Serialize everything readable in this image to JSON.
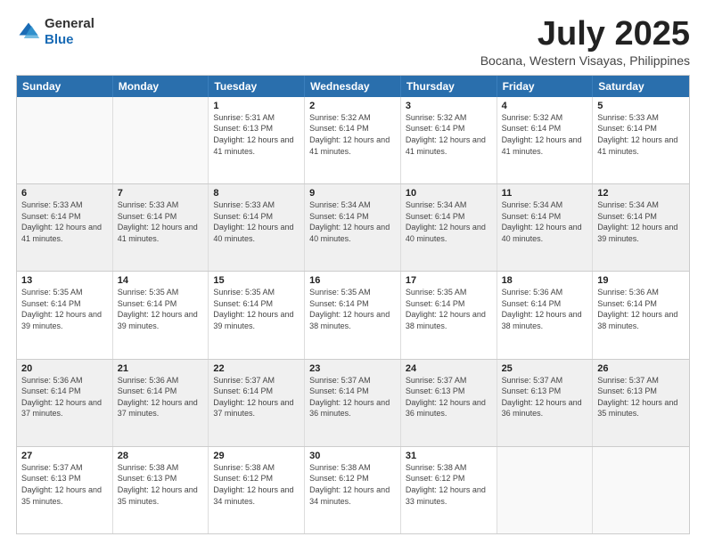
{
  "header": {
    "logo_general": "General",
    "logo_blue": "Blue",
    "month_title": "July 2025",
    "location": "Bocana, Western Visayas, Philippines"
  },
  "weekdays": [
    "Sunday",
    "Monday",
    "Tuesday",
    "Wednesday",
    "Thursday",
    "Friday",
    "Saturday"
  ],
  "rows": [
    [
      {
        "day": "",
        "info": "",
        "empty": true
      },
      {
        "day": "",
        "info": "",
        "empty": true
      },
      {
        "day": "1",
        "info": "Sunrise: 5:31 AM\nSunset: 6:13 PM\nDaylight: 12 hours and 41 minutes."
      },
      {
        "day": "2",
        "info": "Sunrise: 5:32 AM\nSunset: 6:14 PM\nDaylight: 12 hours and 41 minutes."
      },
      {
        "day": "3",
        "info": "Sunrise: 5:32 AM\nSunset: 6:14 PM\nDaylight: 12 hours and 41 minutes."
      },
      {
        "day": "4",
        "info": "Sunrise: 5:32 AM\nSunset: 6:14 PM\nDaylight: 12 hours and 41 minutes."
      },
      {
        "day": "5",
        "info": "Sunrise: 5:33 AM\nSunset: 6:14 PM\nDaylight: 12 hours and 41 minutes."
      }
    ],
    [
      {
        "day": "6",
        "info": "Sunrise: 5:33 AM\nSunset: 6:14 PM\nDaylight: 12 hours and 41 minutes."
      },
      {
        "day": "7",
        "info": "Sunrise: 5:33 AM\nSunset: 6:14 PM\nDaylight: 12 hours and 41 minutes."
      },
      {
        "day": "8",
        "info": "Sunrise: 5:33 AM\nSunset: 6:14 PM\nDaylight: 12 hours and 40 minutes."
      },
      {
        "day": "9",
        "info": "Sunrise: 5:34 AM\nSunset: 6:14 PM\nDaylight: 12 hours and 40 minutes."
      },
      {
        "day": "10",
        "info": "Sunrise: 5:34 AM\nSunset: 6:14 PM\nDaylight: 12 hours and 40 minutes."
      },
      {
        "day": "11",
        "info": "Sunrise: 5:34 AM\nSunset: 6:14 PM\nDaylight: 12 hours and 40 minutes."
      },
      {
        "day": "12",
        "info": "Sunrise: 5:34 AM\nSunset: 6:14 PM\nDaylight: 12 hours and 39 minutes."
      }
    ],
    [
      {
        "day": "13",
        "info": "Sunrise: 5:35 AM\nSunset: 6:14 PM\nDaylight: 12 hours and 39 minutes."
      },
      {
        "day": "14",
        "info": "Sunrise: 5:35 AM\nSunset: 6:14 PM\nDaylight: 12 hours and 39 minutes."
      },
      {
        "day": "15",
        "info": "Sunrise: 5:35 AM\nSunset: 6:14 PM\nDaylight: 12 hours and 39 minutes."
      },
      {
        "day": "16",
        "info": "Sunrise: 5:35 AM\nSunset: 6:14 PM\nDaylight: 12 hours and 38 minutes."
      },
      {
        "day": "17",
        "info": "Sunrise: 5:35 AM\nSunset: 6:14 PM\nDaylight: 12 hours and 38 minutes."
      },
      {
        "day": "18",
        "info": "Sunrise: 5:36 AM\nSunset: 6:14 PM\nDaylight: 12 hours and 38 minutes."
      },
      {
        "day": "19",
        "info": "Sunrise: 5:36 AM\nSunset: 6:14 PM\nDaylight: 12 hours and 38 minutes."
      }
    ],
    [
      {
        "day": "20",
        "info": "Sunrise: 5:36 AM\nSunset: 6:14 PM\nDaylight: 12 hours and 37 minutes."
      },
      {
        "day": "21",
        "info": "Sunrise: 5:36 AM\nSunset: 6:14 PM\nDaylight: 12 hours and 37 minutes."
      },
      {
        "day": "22",
        "info": "Sunrise: 5:37 AM\nSunset: 6:14 PM\nDaylight: 12 hours and 37 minutes."
      },
      {
        "day": "23",
        "info": "Sunrise: 5:37 AM\nSunset: 6:14 PM\nDaylight: 12 hours and 36 minutes."
      },
      {
        "day": "24",
        "info": "Sunrise: 5:37 AM\nSunset: 6:13 PM\nDaylight: 12 hours and 36 minutes."
      },
      {
        "day": "25",
        "info": "Sunrise: 5:37 AM\nSunset: 6:13 PM\nDaylight: 12 hours and 36 minutes."
      },
      {
        "day": "26",
        "info": "Sunrise: 5:37 AM\nSunset: 6:13 PM\nDaylight: 12 hours and 35 minutes."
      }
    ],
    [
      {
        "day": "27",
        "info": "Sunrise: 5:37 AM\nSunset: 6:13 PM\nDaylight: 12 hours and 35 minutes."
      },
      {
        "day": "28",
        "info": "Sunrise: 5:38 AM\nSunset: 6:13 PM\nDaylight: 12 hours and 35 minutes."
      },
      {
        "day": "29",
        "info": "Sunrise: 5:38 AM\nSunset: 6:12 PM\nDaylight: 12 hours and 34 minutes."
      },
      {
        "day": "30",
        "info": "Sunrise: 5:38 AM\nSunset: 6:12 PM\nDaylight: 12 hours and 34 minutes."
      },
      {
        "day": "31",
        "info": "Sunrise: 5:38 AM\nSunset: 6:12 PM\nDaylight: 12 hours and 33 minutes."
      },
      {
        "day": "",
        "info": "",
        "empty": true
      },
      {
        "day": "",
        "info": "",
        "empty": true
      }
    ]
  ]
}
